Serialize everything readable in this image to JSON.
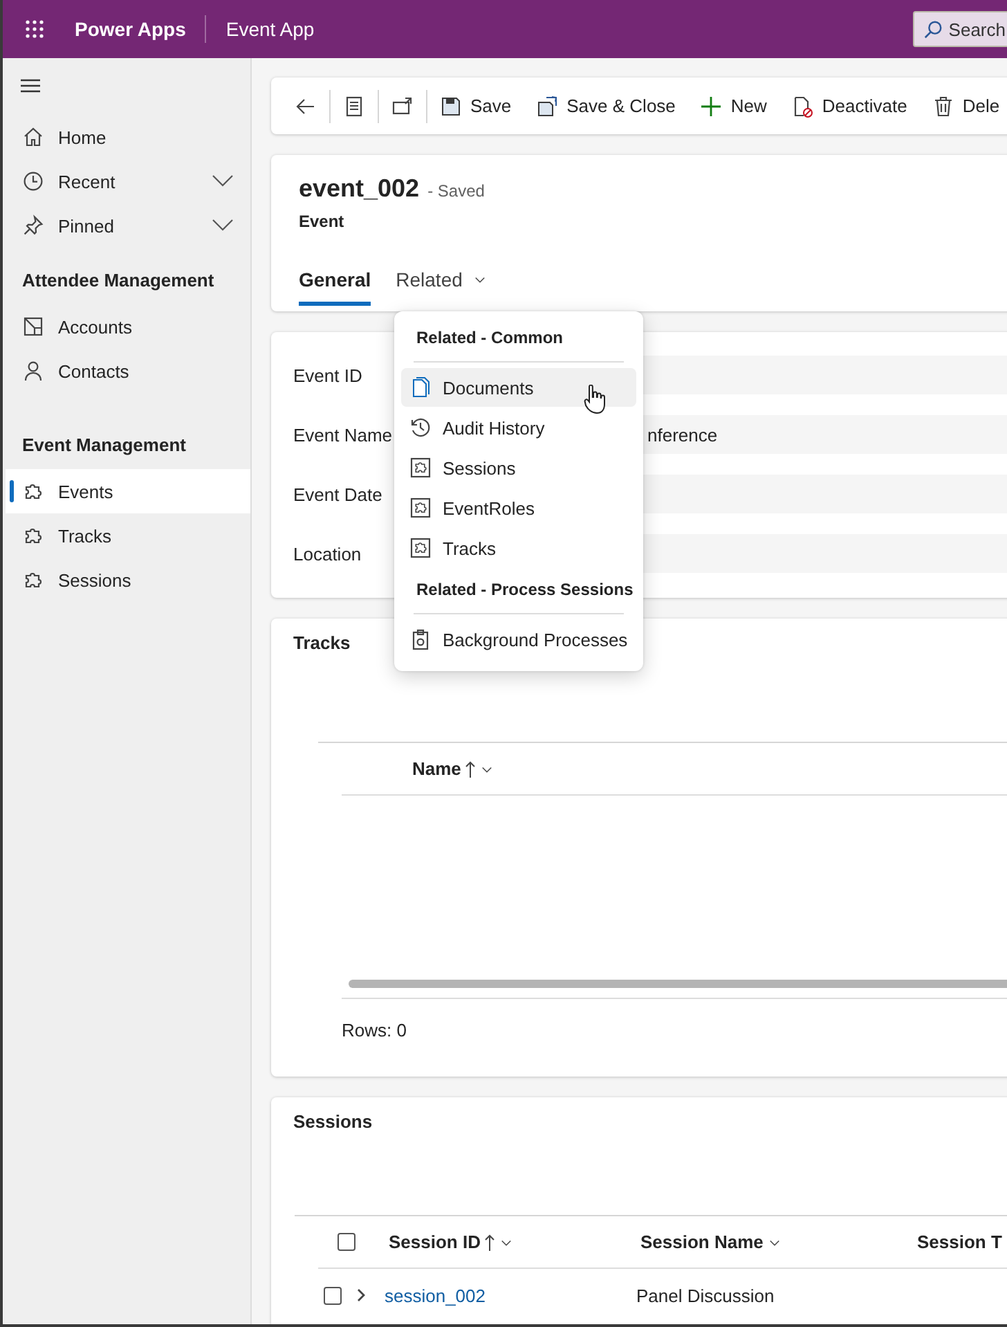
{
  "app_bar": {
    "app_name": "Power Apps",
    "title": "Event App",
    "search": "Search"
  },
  "sidebar": {
    "top": [
      {
        "label": "Home",
        "selected": false
      },
      {
        "label": "Recent",
        "selected": false,
        "expanded": false
      },
      {
        "label": "Pinned",
        "selected": false,
        "expanded": false
      }
    ],
    "groups": [
      {
        "title": "Attendee Management",
        "items": [
          {
            "label": "Accounts",
            "selected": false
          },
          {
            "label": "Contacts",
            "selected": false
          }
        ]
      },
      {
        "title": "Event Management",
        "items": [
          {
            "label": "Events",
            "selected": true
          },
          {
            "label": "Tracks",
            "selected": false
          },
          {
            "label": "Sessions",
            "selected": false
          }
        ]
      }
    ]
  },
  "command_bar": [
    {
      "kind": "icon"
    },
    {
      "kind": "icon"
    },
    {
      "kind": "icon"
    },
    {
      "kind": "text",
      "label": "Save"
    },
    {
      "kind": "text",
      "label": "Save & Close"
    },
    {
      "kind": "text",
      "label": "New"
    },
    {
      "kind": "text",
      "label": "Deactivate"
    },
    {
      "kind": "text",
      "label": "Dele"
    }
  ],
  "record": {
    "title": "event_002",
    "status": "- Saved",
    "entity": "Event"
  },
  "tabs": [
    {
      "label": "General",
      "selected": true,
      "menu": false
    },
    {
      "label": "Related",
      "selected": false,
      "menu": true
    }
  ],
  "fields": [
    {
      "label": "Event ID"
    },
    {
      "label": "Event Name",
      "value": "nference"
    },
    {
      "label": "Event Date"
    },
    {
      "label": "Location"
    }
  ],
  "related_menu": {
    "sections": [
      {
        "title": "Related - Common",
        "items": [
          {
            "label": "Documents",
            "highlighted": true
          },
          {
            "label": "Audit History",
            "highlighted": false
          },
          {
            "label": "Sessions",
            "highlighted": false
          },
          {
            "label": "EventRoles",
            "highlighted": false
          },
          {
            "label": "Tracks",
            "highlighted": false
          }
        ]
      },
      {
        "title": "Related - Process Sessions",
        "items": [
          {
            "label": "Background Processes",
            "highlighted": false
          }
        ]
      }
    ]
  },
  "tracks": {
    "title": "Tracks",
    "columns": [
      {
        "label": "Name",
        "sorted": true,
        "menu": true
      }
    ],
    "footer": "Rows: 0"
  },
  "sessions": {
    "title": "Sessions",
    "select_all_checked": false,
    "columns": [
      {
        "label": "Session ID",
        "sorted": true,
        "menu": true
      },
      {
        "label": "Session Name",
        "sorted": false,
        "menu": true
      },
      {
        "label": "Session T"
      }
    ],
    "rows": [
      {
        "checked": false,
        "cells": [
          "session_002",
          "Panel Discussion"
        ]
      }
    ]
  }
}
